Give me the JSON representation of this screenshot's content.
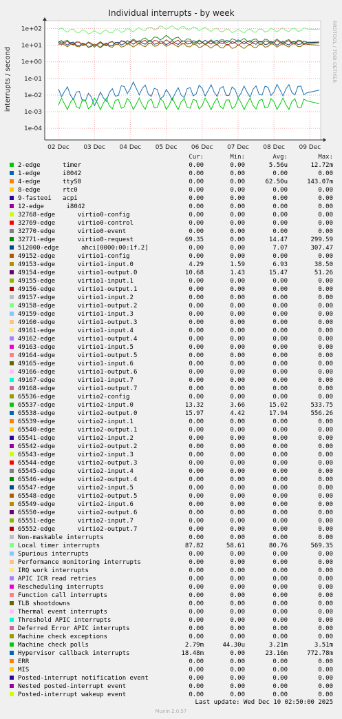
{
  "chart_data": {
    "type": "line",
    "title": "Individual interrupts - by week",
    "ylabel": "interrupts / second",
    "side_label": "RRDTOOL / TOBI OETIKER",
    "y_scale": "log",
    "ylim": [
      2e-05,
      300
    ],
    "y_ticks": [
      "1e+02",
      "1e+01",
      "1e+00",
      "1e-01",
      "1e-02",
      "1e-03",
      "1e-04"
    ],
    "y_tick_values": [
      100,
      10,
      1,
      0.1,
      0.01,
      0.001,
      0.0001
    ],
    "x_ticks": [
      "02 Dec",
      "03 Dec",
      "04 Dec",
      "05 Dec",
      "06 Dec",
      "07 Dec",
      "08 Dec",
      "09 Dec"
    ],
    "series": [
      {
        "name": "Local timer interrupts",
        "color": "#77ee77",
        "approx": [
          87,
          58,
          81,
          120,
          95,
          70,
          82,
          88
        ]
      },
      {
        "name": "65538-edge virtio2-output.0",
        "color": "#228822",
        "approx": [
          18,
          10,
          17,
          30,
          15,
          20,
          18,
          16
        ]
      },
      {
        "name": "65537-edge virtio2-input.0",
        "color": "#1a3d7c",
        "approx": [
          15,
          9,
          15,
          14,
          15,
          16,
          13,
          14
        ]
      },
      {
        "name": "32771-edge virtio0-request",
        "color": "#aa2222",
        "approx": [
          14,
          12,
          15,
          16,
          14,
          13,
          15,
          14
        ]
      },
      {
        "name": "49154-edge virtio1-output.0",
        "color": "#8a6a00",
        "approx": [
          11,
          9,
          10,
          11,
          9,
          8,
          10,
          10
        ]
      },
      {
        "name": "Hypervisor callback interrupts",
        "color": "#1a6fb0",
        "approx": [
          0.02,
          0.005,
          0.03,
          0.01,
          0.02,
          0.015,
          0.02,
          0.02
        ]
      },
      {
        "name": "Machine check polls",
        "color": "#00cc00",
        "approx": [
          0.003,
          0.003,
          0.003,
          0.003,
          0.003,
          0.003,
          0.003,
          0.003
        ]
      }
    ]
  },
  "legend": {
    "header": {
      "cur": "Cur:",
      "min": "Min:",
      "avg": "Avg:",
      "max": "Max:"
    },
    "rows": [
      {
        "label": "2-edge      timer",
        "color": "#00cc00",
        "cur": "0.00",
        "min": "0.00",
        "avg": "5.56u",
        "max": "12.72m"
      },
      {
        "label": "1-edge      i8042",
        "color": "#0066b3",
        "cur": "0.00",
        "min": "0.00",
        "avg": "0.00",
        "max": "0.00"
      },
      {
        "label": "4-edge      ttyS0",
        "color": "#ff8000",
        "cur": "0.00",
        "min": "0.00",
        "avg": "62.50u",
        "max": "143.07m"
      },
      {
        "label": "8-edge      rtc0",
        "color": "#ffcc00",
        "cur": "0.00",
        "min": "0.00",
        "avg": "0.00",
        "max": "0.00"
      },
      {
        "label": "9-fasteoi   acpi",
        "color": "#330099",
        "cur": "0.00",
        "min": "0.00",
        "avg": "0.00",
        "max": "0.00"
      },
      {
        "label": "12-edge      i8042",
        "color": "#990099",
        "cur": "0.00",
        "min": "0.00",
        "avg": "0.00",
        "max": "0.00"
      },
      {
        "label": "32768-edge      virtio0-config",
        "color": "#ccff00",
        "cur": "0.00",
        "min": "0.00",
        "avg": "0.00",
        "max": "0.00"
      },
      {
        "label": "32769-edge      virtio0-control",
        "color": "#ff0000",
        "cur": "0.00",
        "min": "0.00",
        "avg": "0.00",
        "max": "0.00"
      },
      {
        "label": "32770-edge      virtio0-event",
        "color": "#808080",
        "cur": "0.00",
        "min": "0.00",
        "avg": "0.00",
        "max": "0.00"
      },
      {
        "label": "32771-edge      virtio0-request",
        "color": "#008f00",
        "cur": "69.35",
        "min": "0.00",
        "avg": "14.47",
        "max": "299.59"
      },
      {
        "label": "512000-edge      ahci[0000:00:1f.2]",
        "color": "#00487d",
        "cur": "0.00",
        "min": "0.00",
        "avg": "7.07",
        "max": "307.47"
      },
      {
        "label": "49152-edge      virtio1-config",
        "color": "#b35a00",
        "cur": "0.00",
        "min": "0.00",
        "avg": "0.00",
        "max": "0.00"
      },
      {
        "label": "49153-edge      virtio1-input.0",
        "color": "#b38f00",
        "cur": "4.29",
        "min": "1.59",
        "avg": "6.93",
        "max": "38.50"
      },
      {
        "label": "49154-edge      virtio1-output.0",
        "color": "#6b006b",
        "cur": "10.68",
        "min": "1.43",
        "avg": "15.47",
        "max": "51.26"
      },
      {
        "label": "49155-edge      virtio1-input.1",
        "color": "#8fb300",
        "cur": "0.00",
        "min": "0.00",
        "avg": "0.00",
        "max": "0.00"
      },
      {
        "label": "49156-edge      virtio1-output.1",
        "color": "#b30000",
        "cur": "0.00",
        "min": "0.00",
        "avg": "0.00",
        "max": "0.00"
      },
      {
        "label": "49157-edge      virtio1-input.2",
        "color": "#bebebe",
        "cur": "0.00",
        "min": "0.00",
        "avg": "0.00",
        "max": "0.00"
      },
      {
        "label": "49158-edge      virtio1-output.2",
        "color": "#80ff80",
        "cur": "0.00",
        "min": "0.00",
        "avg": "0.00",
        "max": "0.00"
      },
      {
        "label": "49159-edge      virtio1-input.3",
        "color": "#80c9ff",
        "cur": "0.00",
        "min": "0.00",
        "avg": "0.00",
        "max": "0.00"
      },
      {
        "label": "49160-edge      virtio1-output.3",
        "color": "#ffc080",
        "cur": "0.00",
        "min": "0.00",
        "avg": "0.00",
        "max": "0.00"
      },
      {
        "label": "49161-edge      virtio1-input.4",
        "color": "#ffe680",
        "cur": "0.00",
        "min": "0.00",
        "avg": "0.00",
        "max": "0.00"
      },
      {
        "label": "49162-edge      virtio1-output.4",
        "color": "#aa80ff",
        "cur": "0.00",
        "min": "0.00",
        "avg": "0.00",
        "max": "0.00"
      },
      {
        "label": "49163-edge      virtio1-input.5",
        "color": "#ee00cc",
        "cur": "0.00",
        "min": "0.00",
        "avg": "0.00",
        "max": "0.00"
      },
      {
        "label": "49164-edge      virtio1-output.5",
        "color": "#ff8080",
        "cur": "0.00",
        "min": "0.00",
        "avg": "0.00",
        "max": "0.00"
      },
      {
        "label": "49165-edge      virtio1-input.6",
        "color": "#666600",
        "cur": "0.00",
        "min": "0.00",
        "avg": "0.00",
        "max": "0.00"
      },
      {
        "label": "49166-edge      virtio1-output.6",
        "color": "#ffbfff",
        "cur": "0.00",
        "min": "0.00",
        "avg": "0.00",
        "max": "0.00"
      },
      {
        "label": "49167-edge      virtio1-input.7",
        "color": "#00ffcc",
        "cur": "0.00",
        "min": "0.00",
        "avg": "0.00",
        "max": "0.00"
      },
      {
        "label": "49168-edge      virtio1-output.7",
        "color": "#cc6699",
        "cur": "0.00",
        "min": "0.00",
        "avg": "0.00",
        "max": "0.00"
      },
      {
        "label": "65536-edge      virtio2-config",
        "color": "#999900",
        "cur": "0.00",
        "min": "0.00",
        "avg": "0.00",
        "max": "0.00"
      },
      {
        "label": "65537-edge      virtio2-input.0",
        "color": "#00cc00",
        "cur": "13.32",
        "min": "3.66",
        "avg": "15.02",
        "max": "533.75"
      },
      {
        "label": "65538-edge      virtio2-output.0",
        "color": "#0066b3",
        "cur": "15.97",
        "min": "4.42",
        "avg": "17.94",
        "max": "556.26"
      },
      {
        "label": "65539-edge      virtio2-input.1",
        "color": "#ff8000",
        "cur": "0.00",
        "min": "0.00",
        "avg": "0.00",
        "max": "0.00"
      },
      {
        "label": "65540-edge      virtio2-output.1",
        "color": "#ffcc00",
        "cur": "0.00",
        "min": "0.00",
        "avg": "0.00",
        "max": "0.00"
      },
      {
        "label": "65541-edge      virtio2-input.2",
        "color": "#330099",
        "cur": "0.00",
        "min": "0.00",
        "avg": "0.00",
        "max": "0.00"
      },
      {
        "label": "65542-edge      virtio2-output.2",
        "color": "#990099",
        "cur": "0.00",
        "min": "0.00",
        "avg": "0.00",
        "max": "0.00"
      },
      {
        "label": "65543-edge      virtio2-input.3",
        "color": "#ccff00",
        "cur": "0.00",
        "min": "0.00",
        "avg": "0.00",
        "max": "0.00"
      },
      {
        "label": "65544-edge      virtio2-output.3",
        "color": "#ff0000",
        "cur": "0.00",
        "min": "0.00",
        "avg": "0.00",
        "max": "0.00"
      },
      {
        "label": "65545-edge      virtio2-input.4",
        "color": "#808080",
        "cur": "0.00",
        "min": "0.00",
        "avg": "0.00",
        "max": "0.00"
      },
      {
        "label": "65546-edge      virtio2-output.4",
        "color": "#008f00",
        "cur": "0.00",
        "min": "0.00",
        "avg": "0.00",
        "max": "0.00"
      },
      {
        "label": "65547-edge      virtio2-input.5",
        "color": "#00487d",
        "cur": "0.00",
        "min": "0.00",
        "avg": "0.00",
        "max": "0.00"
      },
      {
        "label": "65548-edge      virtio2-output.5",
        "color": "#b35a00",
        "cur": "0.00",
        "min": "0.00",
        "avg": "0.00",
        "max": "0.00"
      },
      {
        "label": "65549-edge      virtio2-input.6",
        "color": "#b38f00",
        "cur": "0.00",
        "min": "0.00",
        "avg": "0.00",
        "max": "0.00"
      },
      {
        "label": "65550-edge      virtio2-output.6",
        "color": "#6b006b",
        "cur": "0.00",
        "min": "0.00",
        "avg": "0.00",
        "max": "0.00"
      },
      {
        "label": "65551-edge      virtio2-input.7",
        "color": "#8fb300",
        "cur": "0.00",
        "min": "0.00",
        "avg": "0.00",
        "max": "0.00"
      },
      {
        "label": "65552-edge      virtio2-output.7",
        "color": "#b30000",
        "cur": "0.00",
        "min": "0.00",
        "avg": "0.00",
        "max": "0.00"
      },
      {
        "label": "Non-maskable interrupts",
        "color": "#bebebe",
        "cur": "0.00",
        "min": "0.00",
        "avg": "0.00",
        "max": "0.00"
      },
      {
        "label": "Local timer interrupts",
        "color": "#80ff80",
        "cur": "87.82",
        "min": "58.61",
        "avg": "80.76",
        "max": "569.35"
      },
      {
        "label": "Spurious interrupts",
        "color": "#80c9ff",
        "cur": "0.00",
        "min": "0.00",
        "avg": "0.00",
        "max": "0.00"
      },
      {
        "label": "Performance monitoring interrupts",
        "color": "#ffc080",
        "cur": "0.00",
        "min": "0.00",
        "avg": "0.00",
        "max": "0.00"
      },
      {
        "label": "IRQ work interrupts",
        "color": "#ffe680",
        "cur": "0.00",
        "min": "0.00",
        "avg": "0.00",
        "max": "0.00"
      },
      {
        "label": "APIC ICR read retries",
        "color": "#aa80ff",
        "cur": "0.00",
        "min": "0.00",
        "avg": "0.00",
        "max": "0.00"
      },
      {
        "label": "Rescheduling interrupts",
        "color": "#ee00cc",
        "cur": "0.00",
        "min": "0.00",
        "avg": "0.00",
        "max": "0.00"
      },
      {
        "label": "Function call interrupts",
        "color": "#ff8080",
        "cur": "0.00",
        "min": "0.00",
        "avg": "0.00",
        "max": "0.00"
      },
      {
        "label": "TLB shootdowns",
        "color": "#666600",
        "cur": "0.00",
        "min": "0.00",
        "avg": "0.00",
        "max": "0.00"
      },
      {
        "label": "Thermal event interrupts",
        "color": "#ffbfff",
        "cur": "0.00",
        "min": "0.00",
        "avg": "0.00",
        "max": "0.00"
      },
      {
        "label": "Threshold APIC interrupts",
        "color": "#00ffcc",
        "cur": "0.00",
        "min": "0.00",
        "avg": "0.00",
        "max": "0.00"
      },
      {
        "label": "Deferred Error APIC interrupts",
        "color": "#cc6699",
        "cur": "0.00",
        "min": "0.00",
        "avg": "0.00",
        "max": "0.00"
      },
      {
        "label": "Machine check exceptions",
        "color": "#999900",
        "cur": "0.00",
        "min": "0.00",
        "avg": "0.00",
        "max": "0.00"
      },
      {
        "label": "Machine check polls",
        "color": "#00cc00",
        "cur": "2.79m",
        "min": "44.30u",
        "avg": "3.21m",
        "max": "3.51m"
      },
      {
        "label": "Hypervisor callback interrupts",
        "color": "#0066b3",
        "cur": "18.48m",
        "min": "0.00",
        "avg": "23.16m",
        "max": "772.78m"
      },
      {
        "label": "ERR",
        "color": "#ff8000",
        "cur": "0.00",
        "min": "0.00",
        "avg": "0.00",
        "max": "0.00"
      },
      {
        "label": "MIS",
        "color": "#ffcc00",
        "cur": "0.00",
        "min": "0.00",
        "avg": "0.00",
        "max": "0.00"
      },
      {
        "label": "Posted-interrupt notification event",
        "color": "#330099",
        "cur": "0.00",
        "min": "0.00",
        "avg": "0.00",
        "max": "0.00"
      },
      {
        "label": "Nested posted-interrupt event",
        "color": "#990099",
        "cur": "0.00",
        "min": "0.00",
        "avg": "0.00",
        "max": "0.00"
      },
      {
        "label": "Posted-interrupt wakeup event",
        "color": "#ccff00",
        "cur": "0.00",
        "min": "0.00",
        "avg": "0.00",
        "max": "0.00"
      }
    ]
  },
  "footer": {
    "last_update": "Last update: Wed Dec 10 02:50:00 2025",
    "version": "Munin 2.0.57"
  }
}
